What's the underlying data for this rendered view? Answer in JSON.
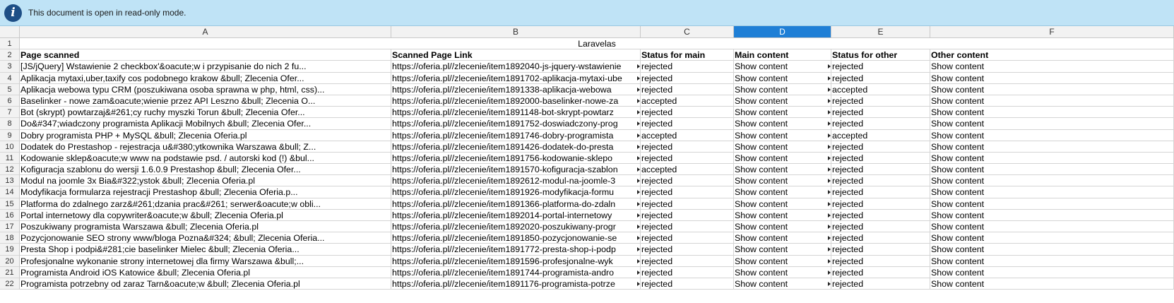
{
  "infobar": {
    "icon": "info-icon",
    "message": "This document is open in read-only mode."
  },
  "columns": [
    "A",
    "B",
    "C",
    "D",
    "E",
    "F"
  ],
  "selected_column": "D",
  "title_row": {
    "row_number": "1",
    "text": "Laravelas"
  },
  "header_row": {
    "row_number": "2",
    "cells": [
      "Page scanned",
      "Scanned Page Link",
      "Status for main",
      "Main content",
      "Status for other",
      "Other content"
    ]
  },
  "rows": [
    {
      "n": "3",
      "a": "[JS/jQuery] Wstawienie 2 checkbox'&oacute;w i przypisanie do nich 2 fu...",
      "b": "https://oferia.pl//zlecenie/item1892040-js-jquery-wstawienie",
      "c": "rejected",
      "d": "Show content",
      "e": "rejected",
      "f": "Show content"
    },
    {
      "n": "4",
      "a": "Aplikacja mytaxi,uber,taxify cos podobnego krakow &bull; Zlecenia Ofer...",
      "b": "https://oferia.pl//zlecenie/item1891702-aplikacja-mytaxi-ube",
      "c": "rejected",
      "d": "Show content",
      "e": "rejected",
      "f": "Show content"
    },
    {
      "n": "5",
      "a": "Aplikacja webowa typu CRM (poszukiwana osoba sprawna w php, html, css)...",
      "b": "https://oferia.pl//zlecenie/item1891338-aplikacja-webowa",
      "c": "rejected",
      "d": "Show content",
      "e": "accepted",
      "f": "Show content"
    },
    {
      "n": "6",
      "a": "Baselinker - nowe zam&oacute;wienie przez API Leszno &bull; Zlecenia O...",
      "b": "https://oferia.pl//zlecenie/item1892000-baselinker-nowe-za",
      "c": "accepted",
      "d": "Show content",
      "e": "rejected",
      "f": "Show content"
    },
    {
      "n": "7",
      "a": "Bot (skrypt) powtarzaj&#261;cy ruchy myszki Torun &bull; Zlecenia Ofer...",
      "b": "https://oferia.pl//zlecenie/item1891148-bot-skrypt-powtarz",
      "c": "rejected",
      "d": "Show content",
      "e": "rejected",
      "f": "Show content"
    },
    {
      "n": "8",
      "a": "Do&#347;wiadczony programista Aplikacji Mobilnych &bull; Zlecenia Ofer...",
      "b": "https://oferia.pl//zlecenie/item1891752-doswiadczony-prog",
      "c": "rejected",
      "d": "Show content",
      "e": "rejected",
      "f": "Show content"
    },
    {
      "n": "9",
      "a": "Dobry programista PHP + MySQL &bull; Zlecenia Oferia.pl",
      "b": "https://oferia.pl//zlecenie/item1891746-dobry-programista",
      "c": "accepted",
      "d": "Show content",
      "e": "accepted",
      "f": "Show content"
    },
    {
      "n": "10",
      "a": "Dodatek do Prestashop - rejestracja u&#380;ytkownika Warszawa &bull; Z...",
      "b": "https://oferia.pl//zlecenie/item1891426-dodatek-do-presta",
      "c": "rejected",
      "d": "Show content",
      "e": "rejected",
      "f": "Show content"
    },
    {
      "n": "11",
      "a": "Kodowanie sklep&oacute;w www na podstawie psd. / autorski kod (!) &bul...",
      "b": "https://oferia.pl//zlecenie/item1891756-kodowanie-sklepo",
      "c": "rejected",
      "d": "Show content",
      "e": "rejected",
      "f": "Show content"
    },
    {
      "n": "12",
      "a": "Kofiguracja szablonu do wersji 1.6.0.9 Prestashop &bull; Zlecenia Ofer...",
      "b": "https://oferia.pl//zlecenie/item1891570-kofiguracja-szablon",
      "c": "accepted",
      "d": "Show content",
      "e": "rejected",
      "f": "Show content"
    },
    {
      "n": "13",
      "a": "Modul na joomle 3x Bia&#322;ystok &bull; Zlecenia Oferia.pl",
      "b": "https://oferia.pl//zlecenie/item1892612-modul-na-joomle-3",
      "c": "rejected",
      "d": "Show content",
      "e": "rejected",
      "f": "Show content"
    },
    {
      "n": "14",
      "a": "Modyfikacja formularza rejestracji Prestashop &bull; Zlecenia Oferia.p...",
      "b": "https://oferia.pl//zlecenie/item1891926-modyfikacja-formu",
      "c": "rejected",
      "d": "Show content",
      "e": "rejected",
      "f": "Show content"
    },
    {
      "n": "15",
      "a": "Platforma do zdalnego zarz&#261;dzania prac&#261; serwer&oacute;w obli...",
      "b": "https://oferia.pl//zlecenie/item1891366-platforma-do-zdaln",
      "c": "rejected",
      "d": "Show content",
      "e": "rejected",
      "f": "Show content"
    },
    {
      "n": "16",
      "a": "Portal internetowy dla copywriter&oacute;w &bull; Zlecenia Oferia.pl",
      "b": "https://oferia.pl//zlecenie/item1892014-portal-internetowy",
      "c": "rejected",
      "d": "Show content",
      "e": "rejected",
      "f": "Show content"
    },
    {
      "n": "17",
      "a": "Poszukiwany programista Warszawa &bull; Zlecenia Oferia.pl",
      "b": "https://oferia.pl//zlecenie/item1892020-poszukiwany-progr",
      "c": "rejected",
      "d": "Show content",
      "e": "rejected",
      "f": "Show content"
    },
    {
      "n": "18",
      "a": "Pozycjonowanie SEO strony www/bloga Pozna&#324; &bull; Zlecenia Oferia...",
      "b": "https://oferia.pl//zlecenie/item1891850-pozycjonowanie-se",
      "c": "rejected",
      "d": "Show content",
      "e": "rejected",
      "f": "Show content"
    },
    {
      "n": "19",
      "a": "Presta Shop  i podpi&#281;cie baselinker Mielec &bull; Zlecenia Oferia...",
      "b": "https://oferia.pl//zlecenie/item1891772-presta-shop-i-podp",
      "c": "rejected",
      "d": "Show content",
      "e": "rejected",
      "f": "Show content"
    },
    {
      "n": "20",
      "a": "Profesjonalne wykonanie strony internetowej dla firmy Warszawa &bull;...",
      "b": "https://oferia.pl//zlecenie/item1891596-profesjonalne-wyk",
      "c": "rejected",
      "d": "Show content",
      "e": "rejected",
      "f": "Show content"
    },
    {
      "n": "21",
      "a": "Programista Android iOS Katowice &bull; Zlecenia Oferia.pl",
      "b": "https://oferia.pl//zlecenie/item1891744-programista-andro",
      "c": "rejected",
      "d": "Show content",
      "e": "rejected",
      "f": "Show content"
    },
    {
      "n": "22",
      "a": "Programista potrzebny od zaraz Tarn&oacute;w &bull; Zlecenia Oferia.pl",
      "b": "https://oferia.pl//zlecenie/item1891176-programista-potrze",
      "c": "rejected",
      "d": "Show content",
      "e": "rejected",
      "f": "Show content"
    }
  ]
}
